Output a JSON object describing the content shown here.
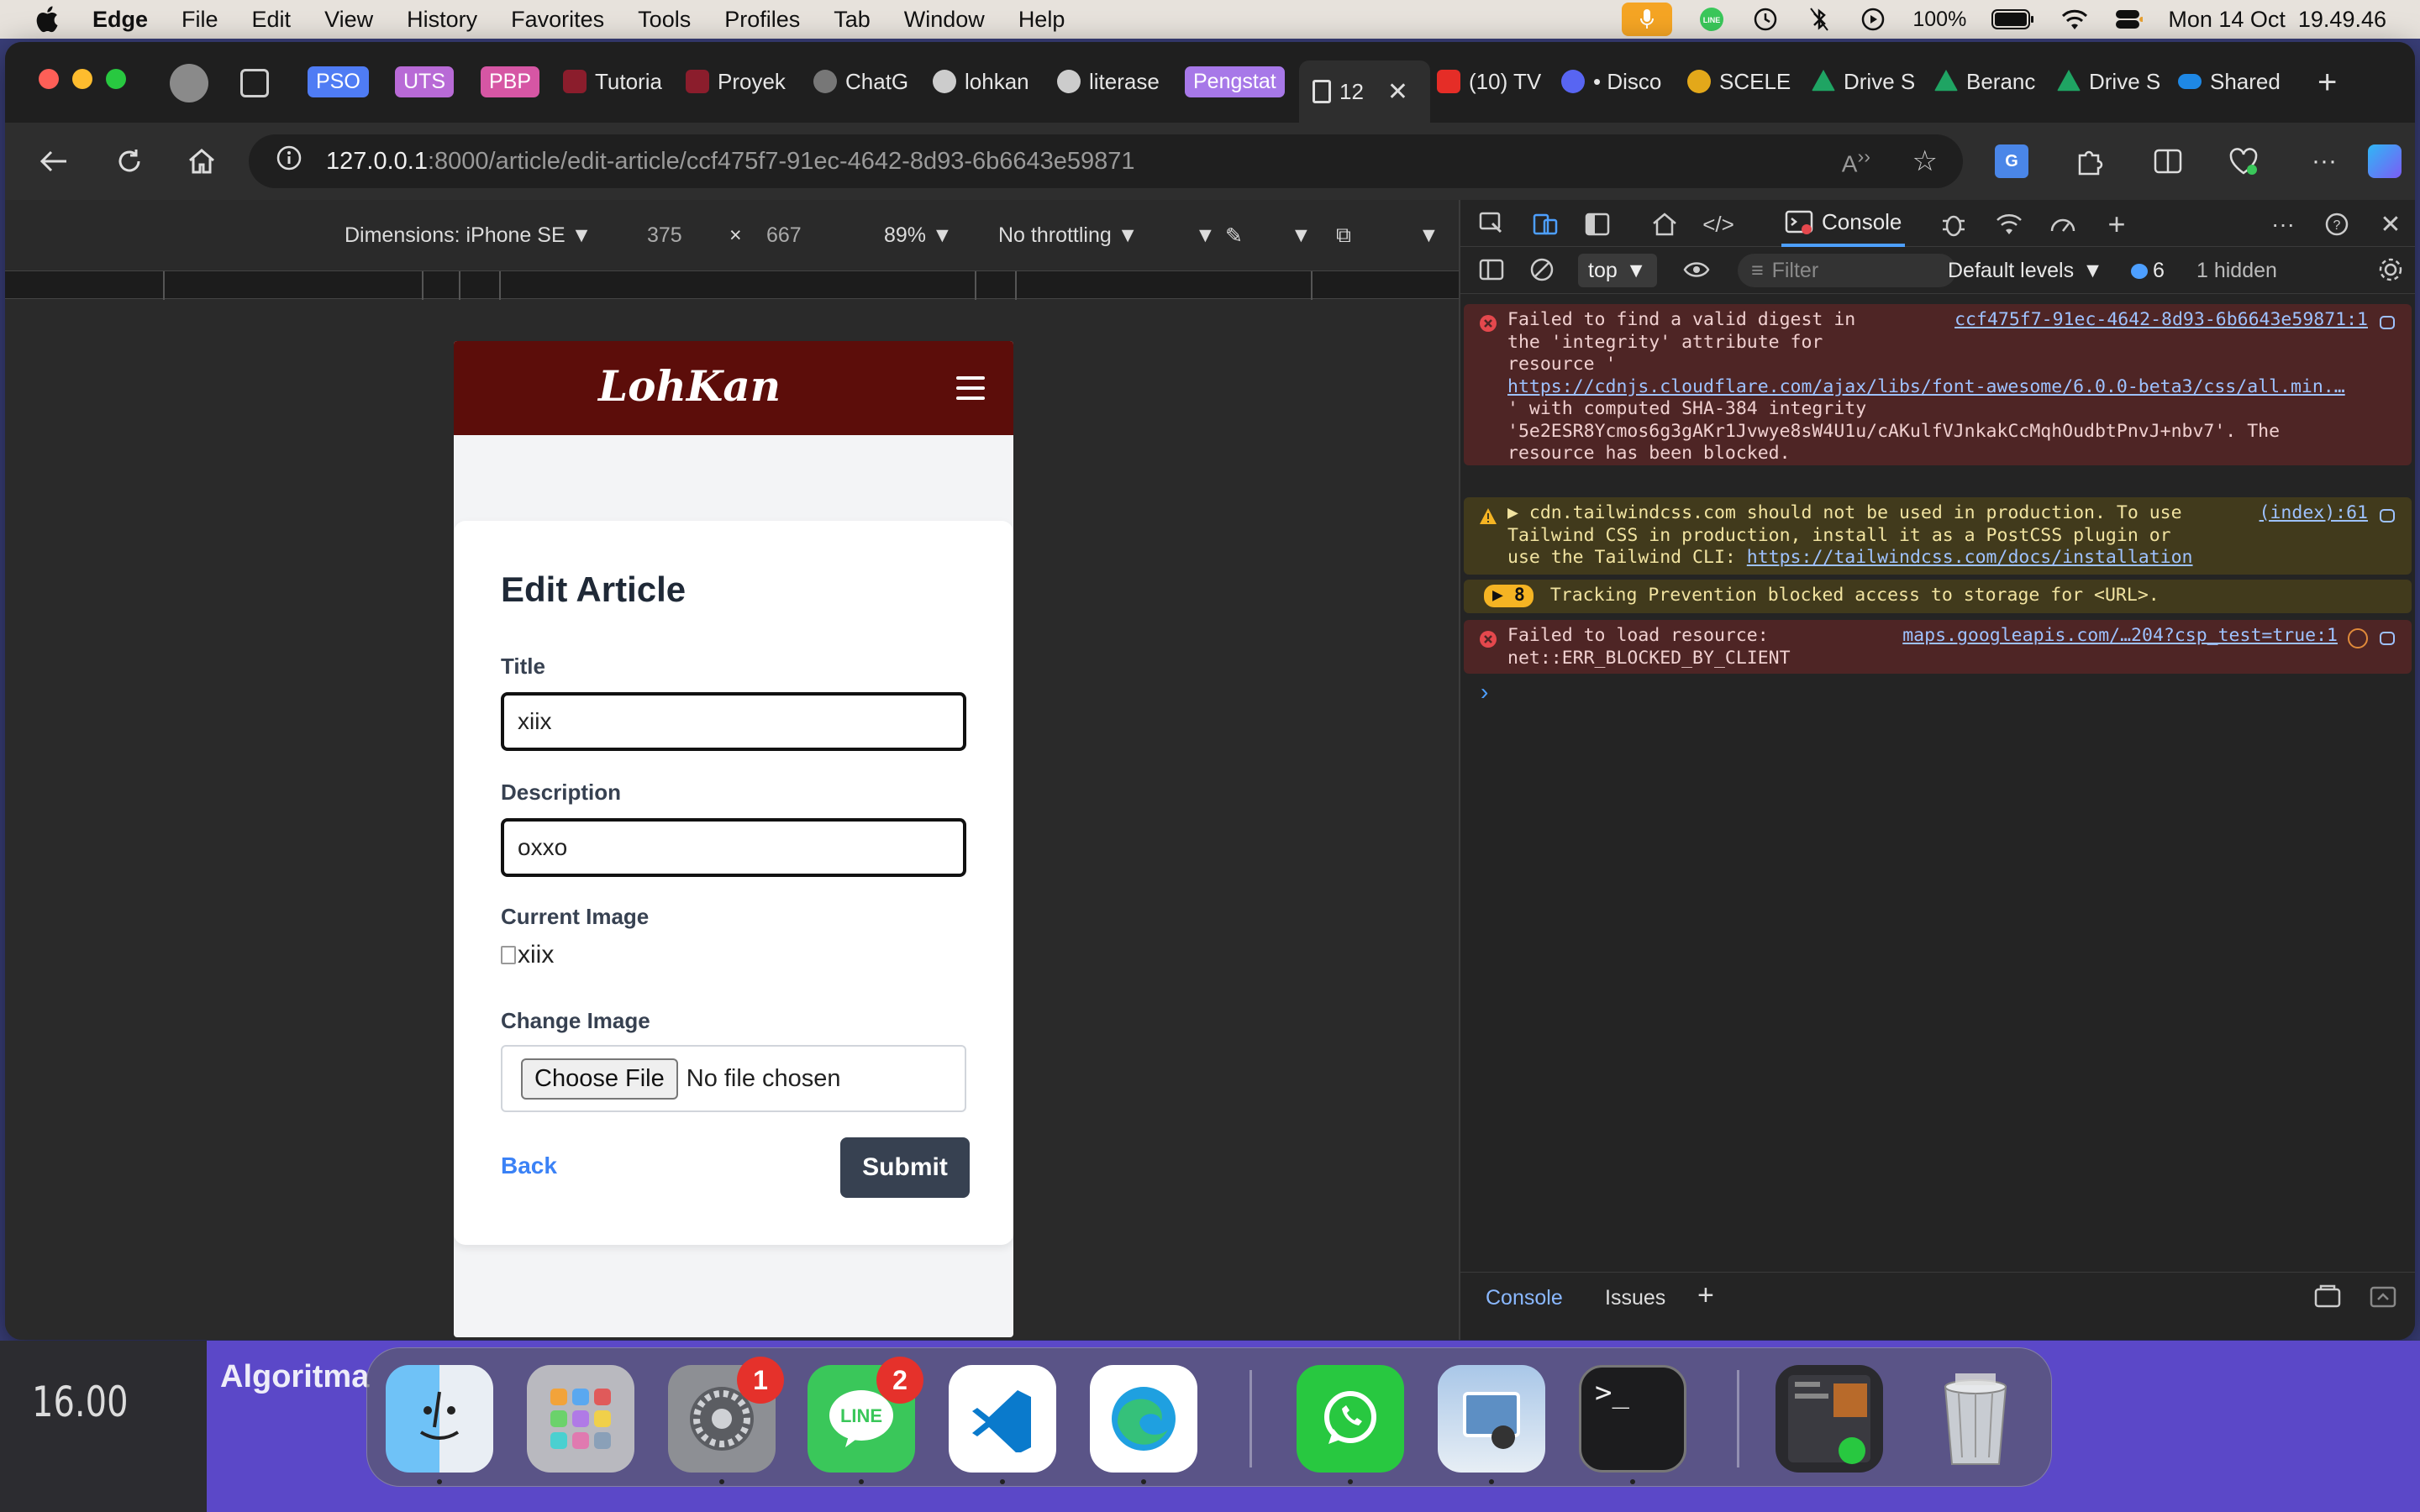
{
  "menubar": {
    "app": "Edge",
    "items": [
      "File",
      "Edit",
      "View",
      "History",
      "Favorites",
      "Tools",
      "Profiles",
      "Tab",
      "Window",
      "Help"
    ],
    "battery": "100%",
    "clock": "Mon 14 Oct  19.49.46"
  },
  "tabs": [
    {
      "label": "PSO",
      "type": "group",
      "color": "#4f7cf4"
    },
    {
      "label": "UTS",
      "type": "group",
      "color": "#b86ad6"
    },
    {
      "label": "PBP",
      "type": "group",
      "color": "#d656a4"
    },
    {
      "label": "Tutoria",
      "type": "tab",
      "color": "#8b1d2c"
    },
    {
      "label": "Proyek",
      "type": "tab",
      "color": "#8b1d2c"
    },
    {
      "label": "ChatG",
      "type": "tab",
      "color": "#777777"
    },
    {
      "label": "lohkan",
      "type": "tab",
      "color": "#cccccc"
    },
    {
      "label": "literase",
      "type": "tab",
      "color": "#cccccc"
    },
    {
      "label": "Pengstat",
      "type": "group",
      "color": "#a778e8"
    },
    {
      "label": "12",
      "type": "active",
      "color": "#e6e6e6"
    },
    {
      "label": "(10) TV",
      "type": "tab",
      "color": "#e52d27"
    },
    {
      "label": "• Disco",
      "type": "tab",
      "color": "#5865f2"
    },
    {
      "label": "SCELE",
      "type": "tab",
      "color": "#e3a81a"
    },
    {
      "label": "Drive S",
      "type": "tab",
      "color": "#1fa463"
    },
    {
      "label": "Beranc",
      "type": "tab",
      "color": "#1fa463"
    },
    {
      "label": "Drive S",
      "type": "tab",
      "color": "#1fa463"
    },
    {
      "label": "Shared",
      "type": "tab",
      "color": "#1e88e5"
    }
  ],
  "url": {
    "host": "127.0.0.1",
    "path": ":8000/article/edit-article/ccf475f7-91ec-4642-8d93-6b6643e59871"
  },
  "device_toolbar": {
    "dimensions": "Dimensions: iPhone SE",
    "width": "375",
    "times": "×",
    "height": "667",
    "zoom": "89%",
    "throttling": "No throttling"
  },
  "site": {
    "logo": "LohKan",
    "heading": "Edit Article",
    "title_label": "Title",
    "title_value": "xiix",
    "desc_label": "Description",
    "desc_value": "oxxo",
    "current_image_label": "Current Image",
    "current_image_alt": "xiix",
    "change_image_label": "Change Image",
    "choose_file": "Choose File",
    "no_file": "No file chosen",
    "back": "Back",
    "submit": "Submit"
  },
  "devtools": {
    "console_tab": "Console",
    "context": "top",
    "filter_placeholder": "Filter",
    "levels": "Default levels",
    "message_count": "6",
    "hidden": "1 hidden",
    "logs": [
      {
        "level": "error",
        "source": "ccf475f7-91ec-4642-8d93-6b6643e59871:1",
        "text1": "Failed to find a valid digest in",
        "text2": "the 'integrity' attribute for",
        "text3": "resource '",
        "link": "https://cdnjs.cloudflare.com/ajax/libs/font-awesome/6.0.0-beta3/css/all.min.…",
        "text4": "' with computed SHA-384 integrity",
        "text5": "'5e2ESR8Ycmos6g3gAKr1Jvwye8sW4U1u/cAKulfVJnkakCcMqhOudbtPnvJ+nbv7'. The",
        "text6": "resource has been blocked."
      },
      {
        "level": "warn",
        "source": "(index):61",
        "text1": "▶ cdn.tailwindcss.com should not be used in production. To use",
        "text2": "Tailwind CSS in production, install it as a PostCSS plugin or",
        "text3": "use the Tailwind CLI: ",
        "link": "https://tailwindcss.com/docs/installation"
      },
      {
        "level": "warn",
        "badge": "▶ 8",
        "text1": "Tracking Prevention blocked access to storage for <URL>."
      },
      {
        "level": "error",
        "source": "maps.googleapis.com/…204?csp_test=true:1",
        "text1": "Failed to load resource:",
        "text2": "net::ERR_BLOCKED_BY_CLIENT"
      }
    ],
    "prompt": "›",
    "bottom_tabs": [
      "Console",
      "Issues"
    ]
  },
  "desktop": {
    "time": "16.00",
    "text": "Algoritma"
  },
  "dock": {
    "apps": [
      "finder",
      "launchpad",
      "system-settings",
      "line",
      "vscode",
      "edge",
      "whatsapp",
      "preview",
      "terminal",
      "downloads",
      "trash"
    ],
    "badges": {
      "system-settings": "1",
      "line": "2"
    }
  },
  "colors": {
    "site_nav": "#5c0d0a",
    "submit_bg": "#374151",
    "back_link": "#3b82f6",
    "error_bg": "#4e2525",
    "warn_bg": "#413a1c",
    "console_accent": "#4d9fff"
  }
}
